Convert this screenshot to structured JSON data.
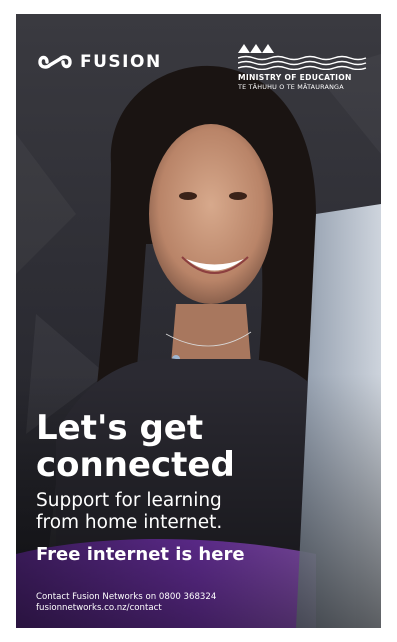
{
  "brand": {
    "fusion_name": "FUSION",
    "ministry_name": "MINISTRY OF EDUCATION",
    "ministry_maori": "TE TĀHUHU O TE MĀTAURANGA"
  },
  "headline": {
    "line1": "Let's get",
    "line2": "connected"
  },
  "subtitle": {
    "line1": "Support for learning",
    "line2": "from home internet."
  },
  "tagline": "Free internet is here",
  "contact": {
    "line1": "Contact Fusion Networks on 0800 368324",
    "line2": "fusionnetworks.co.nz/contact"
  },
  "icons": [
    "infinity-logo-icon",
    "ministry-mountains-icon"
  ],
  "colors": {
    "text": "#ffffff",
    "background_dark": "#2a2a30",
    "accent_purple": "#8a3fd0"
  }
}
